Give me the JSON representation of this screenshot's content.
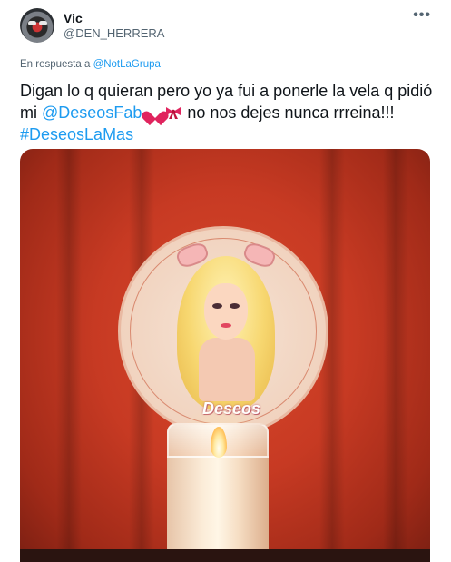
{
  "tweet": {
    "author_name": "Vic",
    "author_handle": "@DEN_HERRERA",
    "more_icon": "more-horizontal-icon",
    "reply_prefix": "En respuesta a",
    "reply_mention": "@NotLaGrupa",
    "text_part1": "Digan lo q quieran pero yo ya fui a ponerle la vela q pidió mi",
    "mention_link": "@DeseosFab",
    "emoji_1": "heart-emoji",
    "emoji_2": "ribbon-emoji",
    "text_part2": "no nos dejes nunca rrreina!!!",
    "hashtag": "#DeseosLaMas"
  },
  "media": {
    "brand_text": "Deseos"
  },
  "colors": {
    "link": "#1d9bf0",
    "secondary_text": "#536471",
    "primary_text": "#0f1419"
  }
}
